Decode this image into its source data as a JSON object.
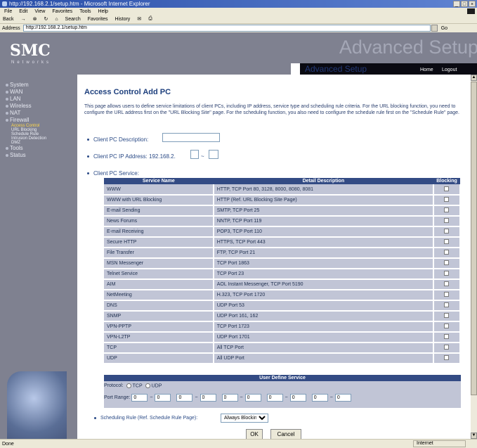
{
  "browser": {
    "title": "http://192.168.2.1/setup.htm - Microsoft Internet Explorer",
    "menu": [
      "File",
      "Edit",
      "View",
      "Favorites",
      "Tools",
      "Help"
    ],
    "toolbar": [
      "Back",
      "Search",
      "Favorites",
      "History"
    ],
    "address_label": "Address",
    "address": "http://192.168.2.1/setup.htm",
    "go": "Go",
    "status_left": "Done",
    "status_zone": "Internet"
  },
  "banner": {
    "logo": "SMC",
    "networks": "Networks",
    "watermark": "Advanced Setup",
    "setup": "Advanced Setup",
    "home": "Home",
    "logout": "Logout"
  },
  "sidebar": {
    "items": [
      "System",
      "WAN",
      "LAN",
      "Wireless",
      "NAT",
      "Firewall"
    ],
    "subitems": [
      "Access Control",
      "URL Blocking",
      "Schedule Rule",
      "Intrusion Detection",
      "DMZ"
    ],
    "bottom": [
      "Tools",
      "Status"
    ]
  },
  "page": {
    "title": "Access Control Add PC",
    "intro": "This page allows users to define service limitations of client PCs, including IP address, service type and scheduling rule criteria. For the URL blocking function, you need to configure the URL address first on the \"URL Blocking Site\" page. For the scheduling function, you also need to configure the schedule rule first on the \"Schedule Rule\" page.",
    "client_desc_label": "Client PC Description:",
    "client_ip_label": "Client PC IP Address: 192.168.2.",
    "client_service_label": "Client PC Service:"
  },
  "table": {
    "headers": [
      "Service Name",
      "Detail Description",
      "Blocking"
    ],
    "rows": [
      [
        "WWW",
        "HTTP, TCP Port 80, 3128, 8000, 8080, 8081"
      ],
      [
        "WWW with URL Blocking",
        "HTTP (Ref. URL Blocking Site Page)"
      ],
      [
        "E-mail Sending",
        "SMTP, TCP Port 25"
      ],
      [
        "News Forums",
        "NNTP, TCP Port 119"
      ],
      [
        "E-mail Receiving",
        "POP3, TCP Port 110"
      ],
      [
        "Secure HTTP",
        "HTTPS, TCP Port 443"
      ],
      [
        "File Transfer",
        "FTP, TCP Port 21"
      ],
      [
        "MSN Messenger",
        "TCP Port 1863"
      ],
      [
        "Telnet Service",
        "TCP Port 23"
      ],
      [
        "AIM",
        "AOL Instant Messenger, TCP Port 5190"
      ],
      [
        "NetMeeting",
        "H.323, TCP Port 1720"
      ],
      [
        "DNS",
        "UDP Port 53"
      ],
      [
        "SNMP",
        "UDP Port 161, 162"
      ],
      [
        "VPN-PPTP",
        "TCP Port 1723"
      ],
      [
        "VPN-L2TP",
        "UDP Port 1701"
      ],
      [
        "TCP",
        "All TCP Port"
      ],
      [
        "UDP",
        "All UDP Port"
      ]
    ]
  },
  "user_defined": {
    "header": "User Define Service",
    "protocol_label": "Protocol:",
    "tcp": "TCP",
    "udp": "UDP",
    "port_label": "Port Range:",
    "ports": [
      "0",
      "0",
      "0",
      "0",
      "0",
      "0",
      "0",
      "0",
      "0",
      "0"
    ]
  },
  "schedule": {
    "label": "Scheduling Rule (Ref. Schedule Rule Page):",
    "value": "Always Blocking"
  },
  "buttons": {
    "ok": "OK",
    "cancel": "Cancel"
  }
}
